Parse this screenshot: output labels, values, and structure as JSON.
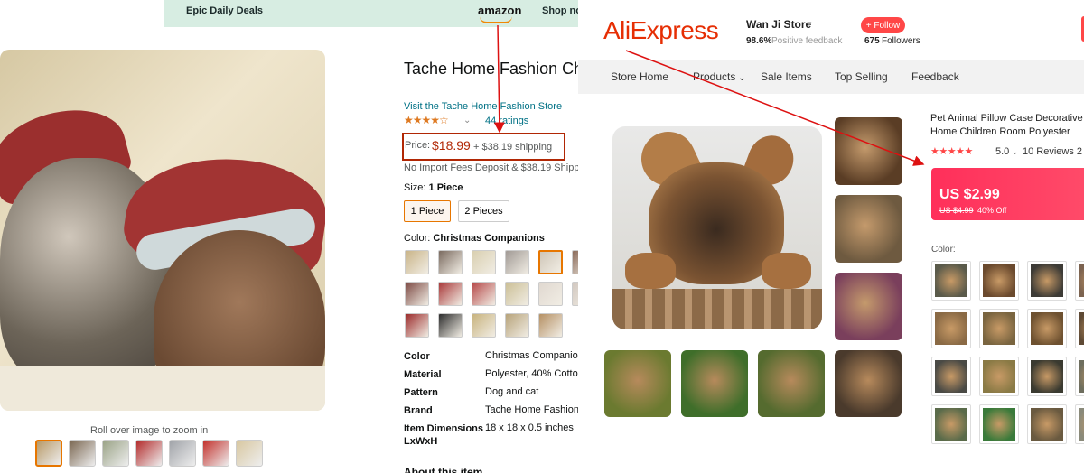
{
  "amazon": {
    "topbar": {
      "deals": "Epic Daily Deals",
      "logo": "amazon",
      "shop": "Shop no"
    },
    "gallery": {
      "roll_over": "Roll over image to zoom in",
      "thumb_colors": [
        "#b89a68",
        "#7a6650",
        "#9aa386",
        "#b32b2b",
        "#a0a3a8",
        "#c2302b",
        "#d8c7a0"
      ]
    },
    "product": {
      "title": "Tache Home Fashion Ch Companions Pillow Cov",
      "store_link": "Visit the Tache Home Fashion Store",
      "stars": "★★★★☆",
      "ratings": "44 ratings",
      "price_label": "Price:",
      "price": "$18.99",
      "shipping": "+ $38.19 shipping",
      "import_fees": "No Import Fees Deposit & $38.19 Shipp",
      "size_label": "Size:",
      "size_value": "1 Piece",
      "sizes": [
        "1 Piece",
        "2 Pieces"
      ],
      "color_label": "Color:",
      "color_value": "Christmas Companions",
      "swatch_colors": [
        "#c9b488",
        "#7b6b60",
        "#d9cfb0",
        "#a19a95",
        "#cfc6b8",
        "#8b6b5a",
        "#7d4a44",
        "#a9393a",
        "#b64a4a",
        "#cbbf96",
        "#e0d8d0",
        "#d2c8c0",
        "#9b2a2a",
        "#2d2d2d",
        "#c8b37e",
        "#b7a37a",
        "#b59063"
      ]
    },
    "specs": [
      {
        "key": "Color",
        "value": "Christmas Companio"
      },
      {
        "key": "Material",
        "value": "Polyester, 40% Cotto"
      },
      {
        "key": "Pattern",
        "value": "Dog and cat"
      },
      {
        "key": "Brand",
        "value": "Tache Home Fashion"
      },
      {
        "key": "Item Dimensions LxWxH",
        "value": "18 x 18 x 0.5 inches"
      }
    ],
    "about": "About this item"
  },
  "aliexpress": {
    "logo": "AliExpress",
    "store": {
      "name": "Wan Ji Store",
      "feedback_pct": "98.6%",
      "feedback_label": "Positive feedback",
      "follow_label": "+ Follow",
      "followers_count": "675",
      "followers_label": "Followers"
    },
    "nav": [
      "Store Home",
      "Products",
      "Sale Items",
      "Top Selling",
      "Feedback"
    ],
    "product": {
      "title": "Pet Animal Pillow Case Decorative a Home Children Room Polyester",
      "stars": "★★★★★",
      "rating": "5.0",
      "reviews": "10 Reviews  2",
      "price": "US $2.99",
      "old_price": "US $4.99",
      "discount": "40% Off",
      "color_label": "Color:"
    },
    "side_thumb_colors": [
      "#5a3d25",
      "#6e5a40",
      "#7a3f5c"
    ],
    "bottom_thumb_colors": [
      "#6b7a30",
      "#3f6e2a",
      "#556b2f",
      "#4a3a2c"
    ],
    "swatch_colors": [
      "#5a5a4a",
      "#6b4a2e",
      "#3d3b36",
      "#7c6350",
      "#8a6a45",
      "#7a6540",
      "#6e5130",
      "#5f4a35",
      "#4a4a45",
      "#8a7a45",
      "#3a3a30",
      "#6e6e5e",
      "#5a6b4a",
      "#3a7a3a",
      "#6a5a40",
      "#8a8a7a"
    ]
  }
}
